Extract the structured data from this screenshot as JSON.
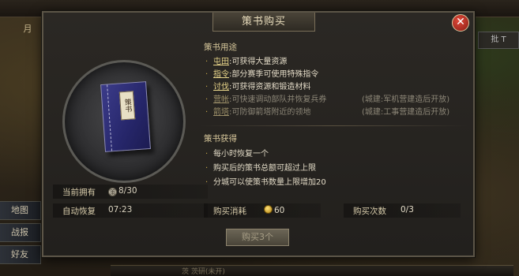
{
  "background": {
    "left_tab": "月",
    "right_box": "批 T",
    "side_menu": [
      "地图",
      "战报",
      "好友"
    ],
    "bottom_text": "茨 茨研(未开)"
  },
  "dialog": {
    "title": "策书购买",
    "close_label": "✕",
    "book_label": "策书",
    "owned_label": "当前拥有",
    "owned_value": "8/30",
    "recover_label": "自动恢复",
    "recover_value": "07:23",
    "usage_title": "策书用途",
    "usages": [
      {
        "link": "屯田",
        "desc": ":可获得大量资源",
        "note": "",
        "dim": false
      },
      {
        "link": "指令",
        "desc": ":部分赛季可使用特殊指令",
        "note": "",
        "dim": false
      },
      {
        "link": "讨伐",
        "desc": ":可获得资源和锻造材料",
        "note": "",
        "dim": false
      },
      {
        "link": "营帐",
        "desc": ":可快速调动部队并恢复兵券",
        "note": "(城建:军机营建造后开放)",
        "dim": true
      },
      {
        "link": "箭塔",
        "desc": ":可防御箭塔附近的领地",
        "note": "(城建:工事营建造后开放)",
        "dim": true
      }
    ],
    "gain_title": "策书获得",
    "gains": [
      "每小时恢复一个",
      "购买后的策书总额可超过上限",
      "分城可以使策书数量上限增加20"
    ],
    "cost_label": "购买消耗",
    "cost_value": "60",
    "count_label": "购买次数",
    "count_value": "0/3",
    "buy_button": "购买3个"
  }
}
